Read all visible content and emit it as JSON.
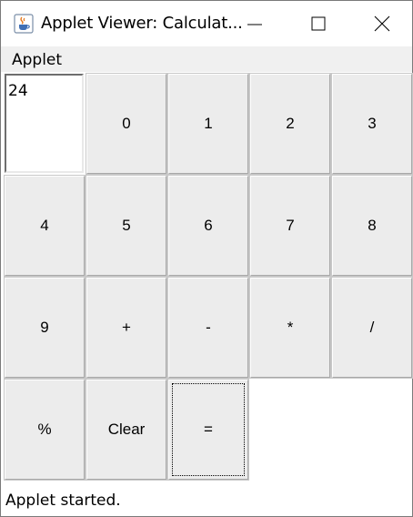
{
  "window": {
    "title": "Applet Viewer: Calculat...",
    "icon": "java-cup-icon"
  },
  "menubar": {
    "items": [
      "Applet"
    ]
  },
  "display": {
    "value": "24"
  },
  "buttons": [
    {
      "label": "0"
    },
    {
      "label": "1"
    },
    {
      "label": "2"
    },
    {
      "label": "3"
    },
    {
      "label": "4"
    },
    {
      "label": "5"
    },
    {
      "label": "6"
    },
    {
      "label": "7"
    },
    {
      "label": "8"
    },
    {
      "label": "9"
    },
    {
      "label": "+"
    },
    {
      "label": "-"
    },
    {
      "label": "*"
    },
    {
      "label": "/"
    },
    {
      "label": "%"
    },
    {
      "label": "Clear"
    },
    {
      "label": "=",
      "focused": true
    }
  ],
  "status": {
    "text": "Applet started."
  }
}
